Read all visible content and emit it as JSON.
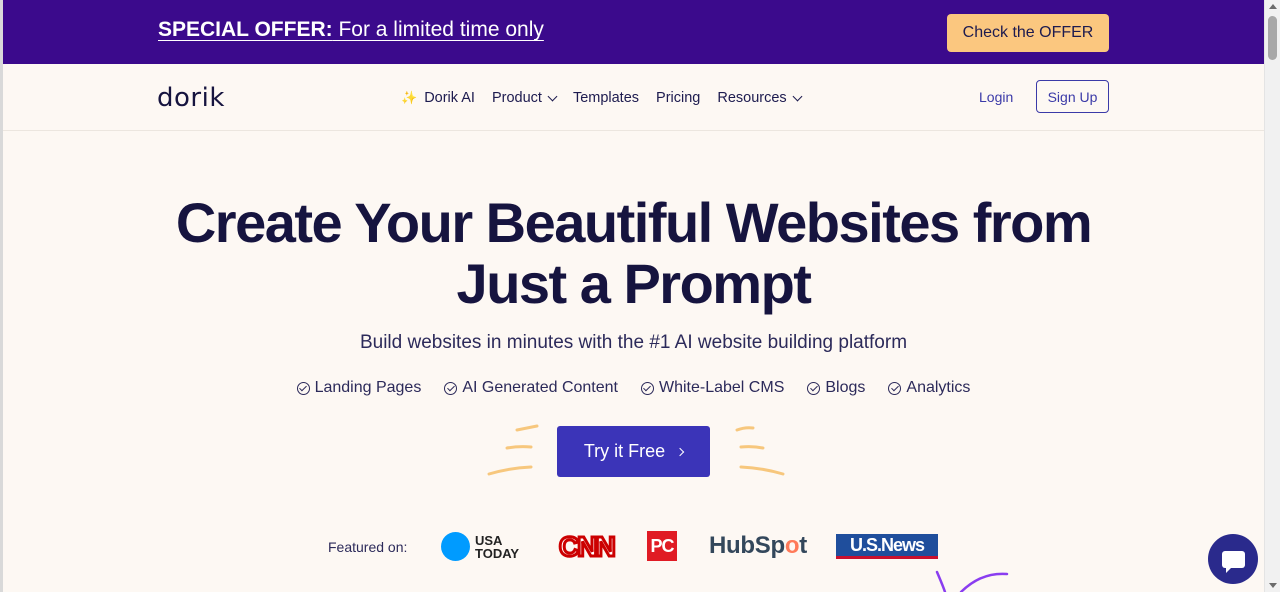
{
  "offer": {
    "bold": "SPECIAL OFFER:",
    "text": " For a limited time only",
    "button": "Check the OFFER"
  },
  "nav": {
    "logo": "dorik",
    "links": {
      "ai": "Dorik AI",
      "product": "Product",
      "templates": "Templates",
      "pricing": "Pricing",
      "resources": "Resources"
    },
    "login": "Login",
    "signup": "Sign Up"
  },
  "hero": {
    "title_line1": "Create Your Beautiful Websites from",
    "title_line2": "Just a Prompt",
    "subtitle": "Build websites in minutes with the #1 AI website building platform",
    "features": [
      "Landing Pages",
      "AI Generated Content",
      "White-Label CMS",
      "Blogs",
      "Analytics"
    ],
    "cta": "Try it Free"
  },
  "featured": {
    "label": "Featured on:",
    "usa_today_line1": "USA",
    "usa_today_line2": "TODAY",
    "cnn": "CNN",
    "pc": "PC",
    "hubspot_pre": "HubSp",
    "hubspot_o": "o",
    "hubspot_post": "t",
    "usnews": "U.S.News"
  },
  "colors": {
    "offer_bg": "#3b0a8c",
    "offer_button": "#fbc77f",
    "cta": "#3b34b8",
    "page_bg": "#fdf8f3",
    "heading": "#16143f"
  },
  "icons": {
    "sparkle": "sparkle-icon",
    "chevron": "chevron-down-icon",
    "check": "check-circle-icon",
    "cta_arrow": "chevron-right-icon",
    "chat": "chat-icon"
  }
}
